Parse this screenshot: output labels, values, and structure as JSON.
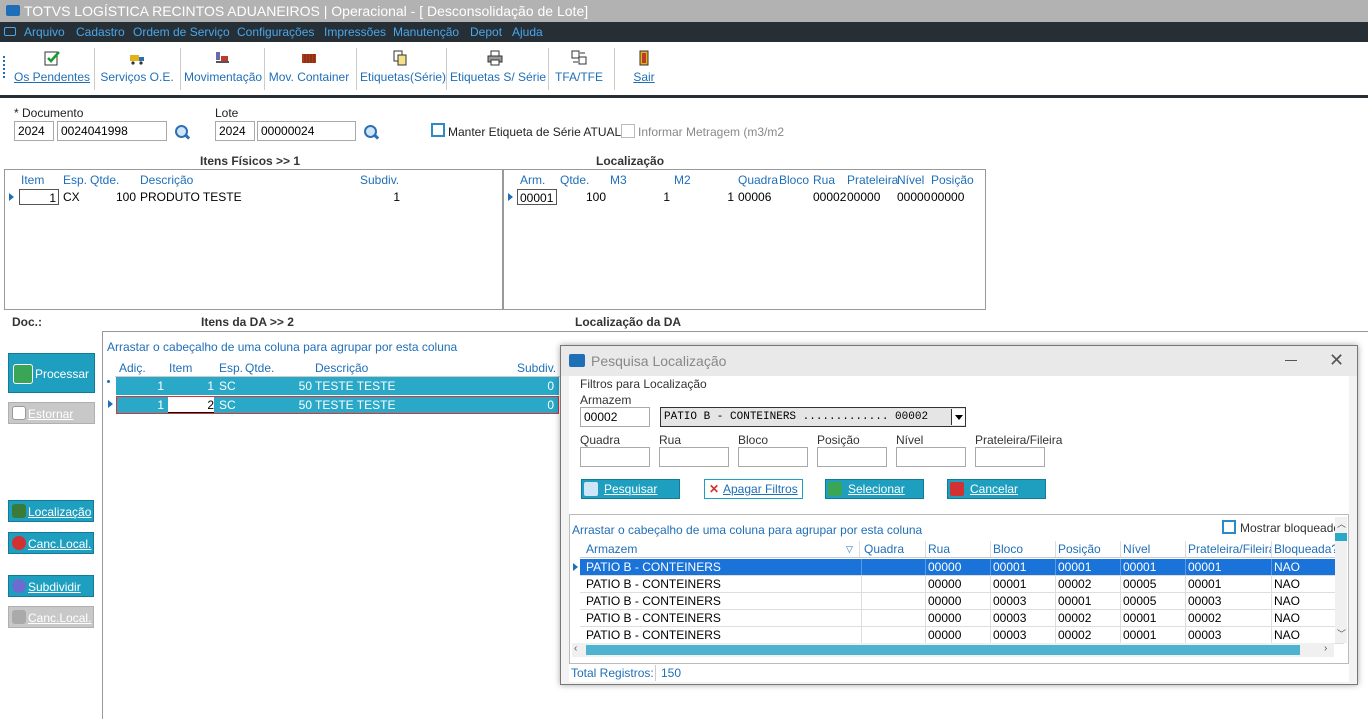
{
  "window": {
    "title": "TOTVS LOGÍSTICA RECINTOS ADUANEIROS | Operacional - [ Desconsolidação de Lote]"
  },
  "menu": [
    "Arquivo",
    "Cadastro",
    "Ordem de Serviço",
    "Configurações",
    "Impressões",
    "Manutenção",
    "Depot",
    "Ajuda"
  ],
  "toolbar": {
    "os_pendentes": "Os Pendentes",
    "servicos_oe": "Serviços O.E.",
    "movimentacao": "Movimentação",
    "mov_container": "Mov. Container",
    "etiquetas_serie": "Etiquetas(Série)",
    "etiquetas_s_serie": "Etiquetas S/ Série",
    "tfa_tfe": "TFA/TFE",
    "sair": "Sair"
  },
  "form": {
    "documento_label": "* Documento",
    "documento_ano": "2024",
    "documento_num": "0024041998",
    "lote_label": "Lote",
    "lote_ano": "2024",
    "lote_num": "00000024",
    "manter_etiqueta_label": "Manter Etiqueta de Série ATUAL",
    "informar_metragem_label": "Informar Metragem (m3/m2"
  },
  "itens_fisicos": {
    "title": "Itens Físicos    >> 1",
    "headers": [
      "Item",
      "Esp.",
      "Qtde.",
      "Descrição",
      "Subdiv."
    ],
    "rows": [
      [
        "1",
        "CX",
        "100",
        "PRODUTO TESTE",
        "1"
      ]
    ]
  },
  "localizacao": {
    "title": "Localização",
    "headers": [
      "Arm.",
      "Qtde.",
      "M3",
      "M2",
      "Quadra",
      "Bloco",
      "Rua",
      "Prateleira",
      "Nível",
      "Posição"
    ],
    "rows": [
      [
        "00001",
        "100",
        "1",
        "1",
        "00006",
        "",
        "00002",
        "00000",
        "00000",
        "00000"
      ]
    ]
  },
  "doc_label": "Doc.:",
  "itens_da": {
    "title": "Itens da DA    >> 2",
    "group_hint": "Arrastar o cabeçalho de uma coluna para agrupar por esta coluna",
    "headers": [
      "Adiç.",
      "Item",
      "Esp.",
      "Qtde.",
      "Descrição",
      "Subdiv."
    ],
    "rows": [
      [
        "1",
        "1",
        "SC",
        "50",
        "TESTE TESTE",
        "0"
      ],
      [
        "1",
        "2",
        "SC",
        "50",
        "TESTE TESTE",
        "0"
      ]
    ]
  },
  "localizacao_da": {
    "title": "Localização da DA"
  },
  "side_buttons": {
    "processar": "Processar",
    "estornar": "Estornar",
    "localizacao": "Localização",
    "canc_local": "Canc.Local.",
    "subdividir": "Subdividir",
    "canc_local2": "Canc.Local."
  },
  "dialog": {
    "title": "Pesquisa Localização",
    "filters_title": "Filtros para Localização",
    "armazem_label": "Armazem",
    "armazem_code": "00002",
    "armazem_select": "PATIO B - CONTEINERS ............. 00002",
    "quadra_label": "Quadra",
    "rua_label": "Rua",
    "bloco_label": "Bloco",
    "posicao_label": "Posição",
    "nivel_label": "Nível",
    "prateleira_label": "Prateleira/Fileira",
    "btn_pesquisar": "Pesquisar",
    "btn_apagar": "Apagar Filtros",
    "btn_selecionar": "Selecionar",
    "btn_cancelar": "Cancelar",
    "group_hint": "Arrastar o cabeçalho de uma coluna para agrupar por esta coluna",
    "mostrar_bloqueados": "Mostrar bloqueados",
    "headers": [
      "Armazem",
      "Quadra",
      "Rua",
      "Bloco",
      "Posição",
      "Nível",
      "Prateleira/Fileira",
      "Bloqueada?"
    ],
    "rows": [
      [
        "PATIO B - CONTEINERS",
        "",
        "00000",
        "00001",
        "00001",
        "00001",
        "00001",
        "NAO"
      ],
      [
        "PATIO B - CONTEINERS",
        "",
        "00000",
        "00001",
        "00002",
        "00005",
        "00001",
        "NAO"
      ],
      [
        "PATIO B - CONTEINERS",
        "",
        "00000",
        "00003",
        "00001",
        "00005",
        "00003",
        "NAO"
      ],
      [
        "PATIO B - CONTEINERS",
        "",
        "00000",
        "00003",
        "00002",
        "00001",
        "00002",
        "NAO"
      ],
      [
        "PATIO B - CONTEINERS",
        "",
        "00000",
        "00003",
        "00002",
        "00001",
        "00003",
        "NAO"
      ]
    ],
    "total_label": "Total Registros:",
    "total_value": "150"
  }
}
